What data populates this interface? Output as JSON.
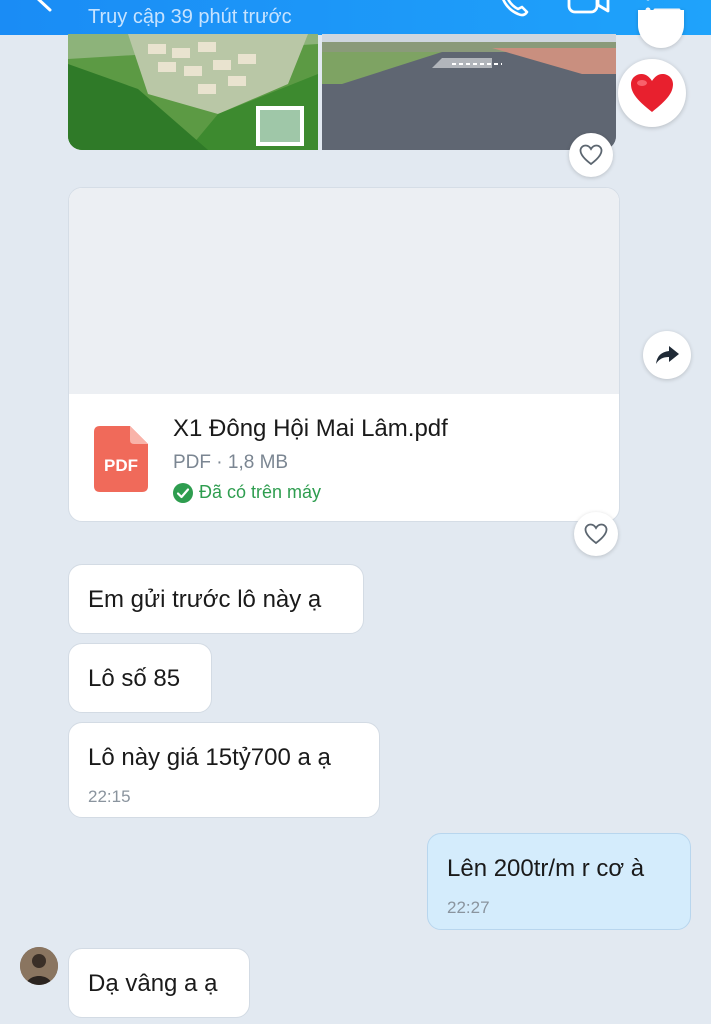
{
  "header": {
    "status": "Truy cập 39 phút trước",
    "icons": [
      "back-icon",
      "phone-icon",
      "video-call-icon",
      "menu-list-icon"
    ]
  },
  "reaction": {
    "icon": "heart-icon",
    "color": "#e8202e"
  },
  "file": {
    "name": "X1 Đông Hội Mai Lâm.pdf",
    "meta": "PDF · 1,8 MB",
    "status": "Đã có trên máy",
    "badge": "PDF",
    "badge_color": "#f06a5a"
  },
  "messages": [
    {
      "text": "Em gửi trước lô này ạ"
    },
    {
      "text": "Lô số 85"
    },
    {
      "text": "Lô này giá 15tỷ700 a ạ",
      "time": "22:15"
    },
    {
      "text": "Lên 200tr/m r cơ à",
      "time": "22:27"
    },
    {
      "text": "Dạ vâng a ạ"
    }
  ],
  "colors": {
    "accent": "#1a8cf5",
    "outgoing": "#d4ecfc",
    "background": "#e2e9f1",
    "success": "#2e9d4f"
  }
}
